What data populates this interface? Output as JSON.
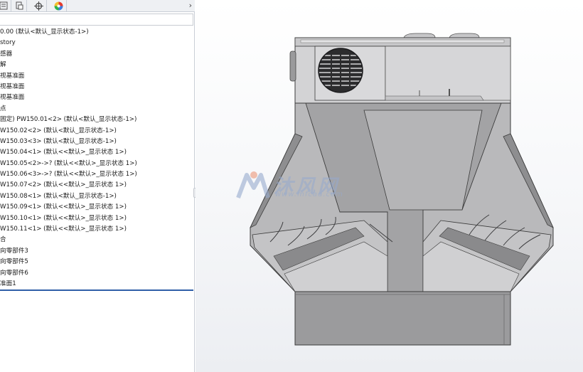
{
  "panel": {
    "scroll_arrow": "›",
    "tabs": [
      {
        "name": "feature-manager-tab"
      },
      {
        "name": "property-manager-tab"
      },
      {
        "name": "configuration-manager-tab"
      },
      {
        "name": "display-manager-tab"
      }
    ],
    "tree_items": [
      "0.00 (默认<默认_显示状态-1>)",
      "story",
      "感器",
      "解",
      "视基准面",
      "视基准面",
      "视基准面",
      "点",
      "固定) PW150.01<2> (默认<默认_显示状态-1>)",
      "W150.02<2> (默认<默认_显示状态-1>)",
      "W150.03<3> (默认<默认_显示状态-1>)",
      "W150.04<1> (默认<<默认>_显示状态 1>)",
      "W150.05<2>->? (默认<<默认>_显示状态 1>)",
      "W150.06<3>->? (默认<<默认>_显示状态 1>)",
      "W150.07<2> (默认<<默认>_显示状态 1>)",
      "W150.08<1> (默认<默认_显示状态-1>)",
      "W150.09<1> (默认<<默认>_显示状态 1>)",
      "W150.10<1> (默认<<默认>_显示状态 1>)",
      "W150.11<1> (默认<<默认>_显示状态 1>)",
      "合",
      "向零部件3",
      "向零部件5",
      "向零部件6",
      "准面1"
    ]
  },
  "watermark": {
    "text": "沐风网",
    "url": "www.mfcad.com"
  },
  "colors": {
    "accent": "#2f5fa8",
    "model_light": "#d2d2d4",
    "model_mid": "#a9a9ab",
    "model_dark": "#7e7e80"
  }
}
